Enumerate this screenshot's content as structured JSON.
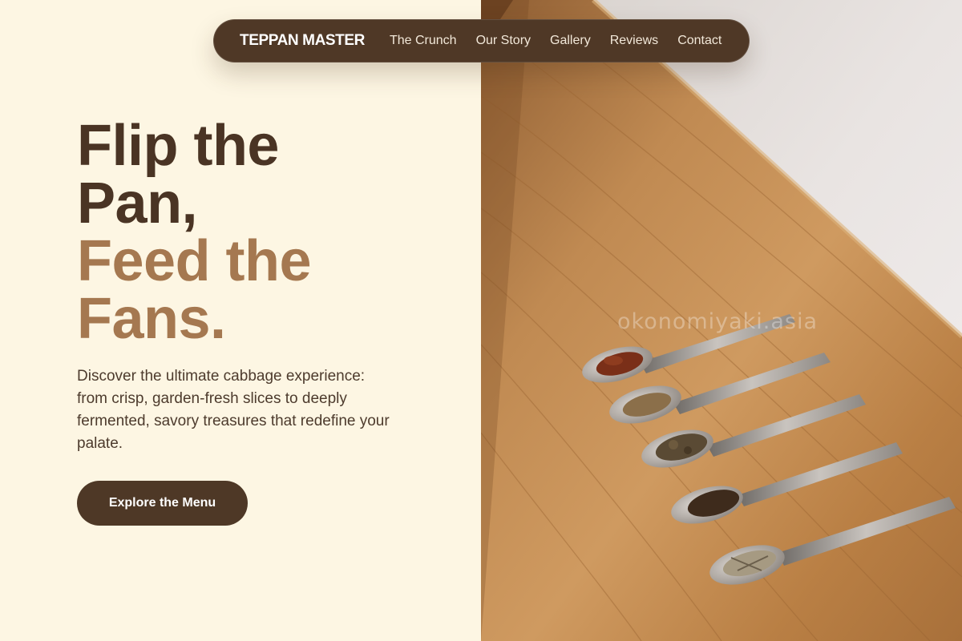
{
  "nav": {
    "brand": "TEPPAN MASTER",
    "links": [
      "The Crunch",
      "Our Story",
      "Gallery",
      "Reviews",
      "Contact"
    ]
  },
  "hero": {
    "title_line1": "Flip the",
    "title_line2": "Pan,",
    "title_line3": "Feed the",
    "title_line4": "Fans.",
    "description": "Discover the ultimate cabbage experience: from crisp, garden-fresh slices to deeply fermented, savory treasures that redefine your palate.",
    "cta_label": "Explore the Menu"
  },
  "image": {
    "watermark": "okonomiyaki.asia",
    "alt": "Five spoons of dried spices on a wooden board"
  },
  "colors": {
    "background": "#fdf6e3",
    "nav": "#4f3826",
    "title_dark": "#4a3424",
    "title_accent": "#a57850",
    "button": "#4e3826"
  }
}
